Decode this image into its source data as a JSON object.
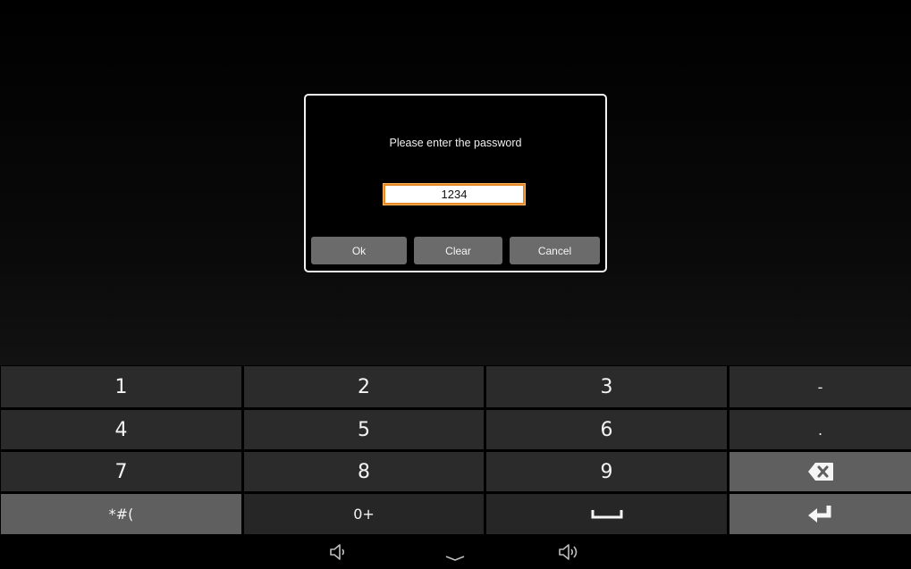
{
  "dialog": {
    "title": "Please enter the password",
    "password_value": "1234",
    "buttons": {
      "ok": "Ok",
      "clear": "Clear",
      "cancel": "Cancel"
    }
  },
  "keyboard": {
    "row1": [
      "1",
      "2",
      "3",
      "-"
    ],
    "row2": [
      "4",
      "5",
      "6",
      "."
    ],
    "row3": [
      "7",
      "8",
      "9"
    ],
    "row3_special_icon": "backspace-icon",
    "row4": {
      "symbols": "*#(",
      "zero_plus": "0+",
      "space_icon": "space-bar-icon",
      "enter_icon": "enter-icon"
    }
  },
  "navbar": {
    "icons": [
      "volume-down-icon",
      "chevron-down-icon",
      "volume-up-icon"
    ]
  },
  "colors": {
    "dialog_border": "#f2f2f2",
    "input_border_focus": "#e3892a",
    "dialog_button": "#6b6b6b",
    "key": "#2b2b2b",
    "key_special": "#5f5f5f"
  }
}
